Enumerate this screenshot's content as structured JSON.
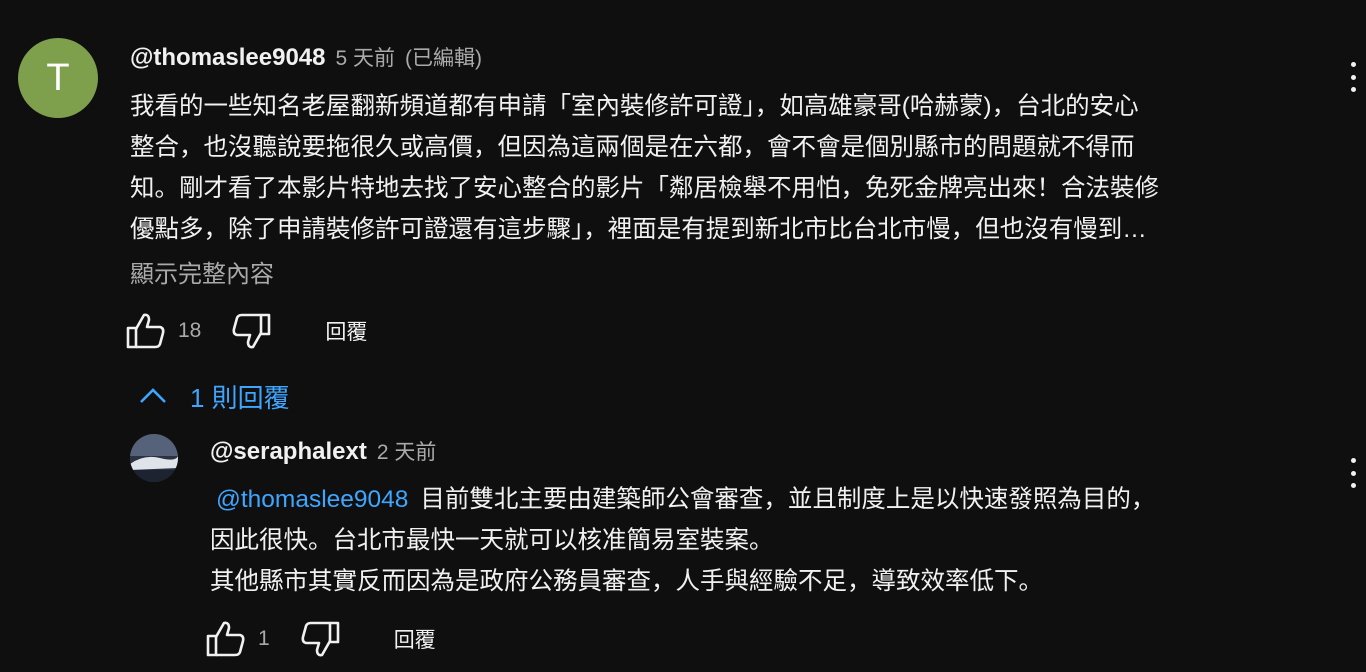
{
  "comment": {
    "avatar_letter": "T",
    "avatar_color": "#7ea04d",
    "author": "@thomaslee9048",
    "time": "5 天前",
    "edited": "(已編輯)",
    "lines": [
      "我看的一些知名老屋翻新頻道都有申請「室內裝修許可證」，如高雄豪哥(哈赫蒙)，台北的安心",
      "整合，也沒聽說要拖很久或高價，但因為這兩個是在六都，會不會是個別縣市的問題就不得而",
      "知。剛才看了本影片特地去找了安心整合的影片「鄰居檢舉不用怕，免死金牌亮出來！合法裝修",
      "優點多，除了申請裝修許可證還有這步驟」，裡面是有提到新北市比台北市慢，但也沒有慢到…"
    ],
    "show_more": "顯示完整內容",
    "like_count": "18",
    "reply_label": "回覆",
    "replies_toggle": "1 則回覆",
    "menu_icon": "more-vert-icon"
  },
  "reply": {
    "author": "@seraphalext",
    "time": "2 天前",
    "mention": "@thomaslee9048",
    "line1": "目前雙北主要由建築師公會審查，並且制度上是以快速發照為目的，",
    "line2": "因此很快。台北市最快一天就可以核准簡易室裝案。",
    "line3": "其他縣市其實反而因為是政府公務員審查，人手與經驗不足，導致效率低下。",
    "like_count": "1",
    "reply_label": "回覆"
  },
  "colors": {
    "background": "#0f0f0f",
    "link": "#3ea6ff",
    "secondary_text": "#aaaaaa"
  }
}
